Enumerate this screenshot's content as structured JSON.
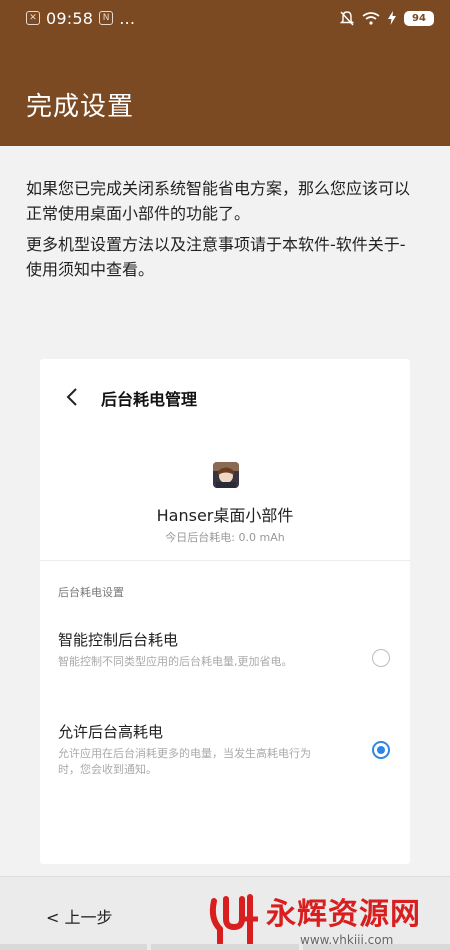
{
  "status_bar": {
    "time": "09:58",
    "notif_badge": "N",
    "extra": "…",
    "battery": "94"
  },
  "app_bar": {
    "title": "完成设置"
  },
  "main": {
    "paragraph1": "如果您已完成关闭系统智能省电方案，那么您应该可以正常使用桌面小部件的功能了。",
    "paragraph2": "更多机型设置方法以及注意事项请于本软件-软件关于-使用须知中查看。"
  },
  "card": {
    "title": "后台耗电管理",
    "app_name": "Hanser桌面小部件",
    "usage": "今日后台耗电: 0.0 mAh",
    "section": "后台耗电设置",
    "options": [
      {
        "title": "智能控制后台耗电",
        "desc": "智能控制不同类型应用的后台耗电量,更加省电。",
        "selected": false
      },
      {
        "title": "允许后台高耗电",
        "desc": "允许应用在后台消耗更多的电量，当发生高耗电行为时，您会收到通知。",
        "selected": true
      }
    ]
  },
  "bottom": {
    "prev_label": "< 上一步",
    "watermark_text": "永辉资源网",
    "watermark_url": "www.yhkjjj.com"
  },
  "colors": {
    "brand": "#7b4a23",
    "accent": "#2f86e6",
    "watermark": "#d81e1e"
  }
}
